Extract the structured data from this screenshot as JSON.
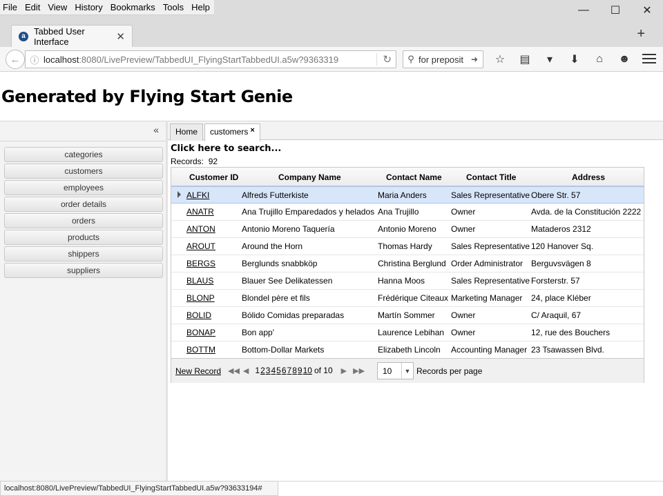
{
  "menu": [
    "File",
    "Edit",
    "View",
    "History",
    "Bookmarks",
    "Tools",
    "Help"
  ],
  "browser": {
    "tab_title": "Tabbed User Interface",
    "url_host": "localhost",
    "url_rest": ":8080/LivePreview/TabbedUI_FlyingStartTabbedUI.a5w?9363319",
    "search_text": "for preposit",
    "status_url": "localhost:8080/LivePreview/TabbedUI_FlyingStartTabbedUI.a5w?93633194#"
  },
  "page": {
    "title": "Generated by Flying Start Genie",
    "collapse": "«"
  },
  "sidebar": {
    "items": [
      "categories",
      "customers",
      "employees",
      "order details",
      "orders",
      "products",
      "shippers",
      "suppliers"
    ]
  },
  "tabs": {
    "home": "Home",
    "customers": "customers",
    "close": "×"
  },
  "grid": {
    "search_link": "Click here to search...",
    "records_label": "Records:",
    "records_count": "92",
    "columns": [
      "Customer ID",
      "Company Name",
      "Contact Name",
      "Contact Title",
      "Address"
    ],
    "rows": [
      [
        "ALFKI",
        "Alfreds Futterkiste",
        "Maria Anders",
        "Sales Representative",
        "Obere Str. 57"
      ],
      [
        "ANATR",
        "Ana Trujillo Emparedados y helados",
        "Ana Trujillo",
        "Owner",
        "Avda. de la Constitución 2222"
      ],
      [
        "ANTON",
        "Antonio Moreno Taquería",
        "Antonio Moreno",
        "Owner",
        "Mataderos 2312"
      ],
      [
        "AROUT",
        "Around the Horn",
        "Thomas Hardy",
        "Sales Representative",
        "120 Hanover Sq."
      ],
      [
        "BERGS",
        "Berglunds snabbköp",
        "Christina Berglund",
        "Order Administrator",
        "Berguvsvägen 8"
      ],
      [
        "BLAUS",
        "Blauer See Delikatessen",
        "Hanna Moos",
        "Sales Representative",
        "Forsterstr. 57"
      ],
      [
        "BLONP",
        "Blondel père et fils",
        "Frédérique Citeaux",
        "Marketing Manager",
        "24, place Kléber"
      ],
      [
        "BOLID",
        "Bólido Comidas preparadas",
        "Martín Sommer",
        "Owner",
        "C/ Araquil, 67"
      ],
      [
        "BONAP",
        "Bon app'",
        "Laurence Lebihan",
        "Owner",
        "12, rue des Bouchers"
      ],
      [
        "BOTTM",
        "Bottom-Dollar Markets",
        "Elizabeth Lincoln",
        "Accounting Manager",
        "23 Tsawassen Blvd."
      ]
    ],
    "new_record": "New Record",
    "pages": [
      "1",
      "2",
      "3",
      "4",
      "5",
      "6",
      "7",
      "8",
      "9",
      "10"
    ],
    "of_label": "of 10",
    "per_page_value": "10",
    "per_page_label": "Records per page"
  }
}
